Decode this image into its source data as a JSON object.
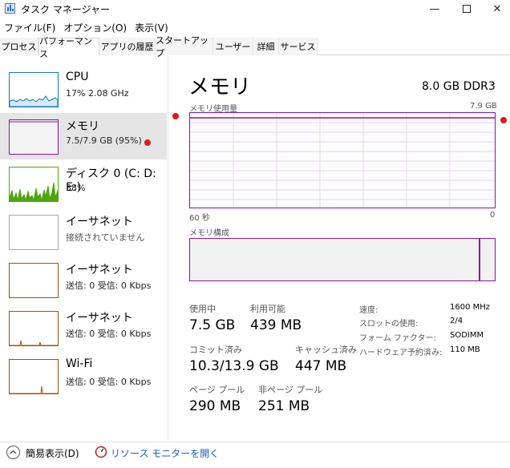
{
  "window": {
    "title": "タスク マネージャー",
    "minimize_glyph": "—",
    "close_glyph": "✕"
  },
  "menu": [
    "ファイル(F)",
    "オプション(O)",
    "表示(V)"
  ],
  "tabs": [
    {
      "label": "プロセス",
      "active": false
    },
    {
      "label": "パフォーマンス",
      "active": true
    },
    {
      "label": "アプリの履歴",
      "active": false
    },
    {
      "label": "スタートアップ",
      "active": false
    },
    {
      "label": "ユーザー",
      "active": false
    },
    {
      "label": "詳細",
      "active": false
    },
    {
      "label": "サービス",
      "active": false
    }
  ],
  "sidebar": {
    "items": [
      {
        "title": "CPU",
        "sub": "17%  2.08 GHz",
        "color": "#117dbb",
        "selected": false
      },
      {
        "title": "メモリ",
        "sub": "7.5/7.9 GB (95%)",
        "color": "#8b12ae",
        "selected": true
      },
      {
        "title": "ディスク 0 (C: D: E:)",
        "sub": "38%",
        "color": "#4da60c",
        "selected": false
      },
      {
        "title": "イーサネット",
        "sub": "接続されていません",
        "color": "#a7a7a7",
        "selected": false
      },
      {
        "title": "イーサネット",
        "sub": "送信: 0 受信: 0 Kbps",
        "color": "#a74f01",
        "selected": false
      },
      {
        "title": "イーサネット",
        "sub": "送信: 0 受信: 0 Kbps",
        "color": "#a74f01",
        "selected": false
      },
      {
        "title": "Wi-Fi",
        "sub": "送信: 0 受信: 0 Kbps",
        "color": "#a74f01",
        "selected": false
      }
    ]
  },
  "main": {
    "title": "メモリ",
    "spec": "8.0 GB DDR3",
    "usage_label": "メモリ使用量",
    "usage_max": "7.9 GB",
    "axis_left": "60 秒",
    "axis_right": "0",
    "composition_label": "メモリ構成",
    "usage_percent": 95,
    "stats": {
      "in_use_label": "使用中",
      "in_use_value": "7.5 GB",
      "available_label": "利用可能",
      "available_value": "439 MB",
      "committed_label": "コミット済み",
      "committed_value": "10.3/13.9 GB",
      "cached_label": "キャッシュ済み",
      "cached_value": "447 MB",
      "paged_label": "ページ プール",
      "paged_value": "290 MB",
      "nonpaged_label": "非ページ プール",
      "nonpaged_value": "251 MB"
    },
    "properties": [
      {
        "label": "速度:",
        "value": "1600 MHz"
      },
      {
        "label": "スロットの使用:",
        "value": "2/4"
      },
      {
        "label": "フォーム ファクター:",
        "value": "SODIMM"
      },
      {
        "label": "ハードウェア予約済み:",
        "value": "110 MB"
      }
    ]
  },
  "footer": {
    "simple_view": "簡易表示(D)",
    "resource_monitor": "リソース モニターを開く"
  },
  "colors": {
    "memory": "#8b12ae",
    "cpu": "#117dbb",
    "disk": "#4da60c",
    "ethernet": "#a74f01",
    "link": "#1a5fb4"
  }
}
